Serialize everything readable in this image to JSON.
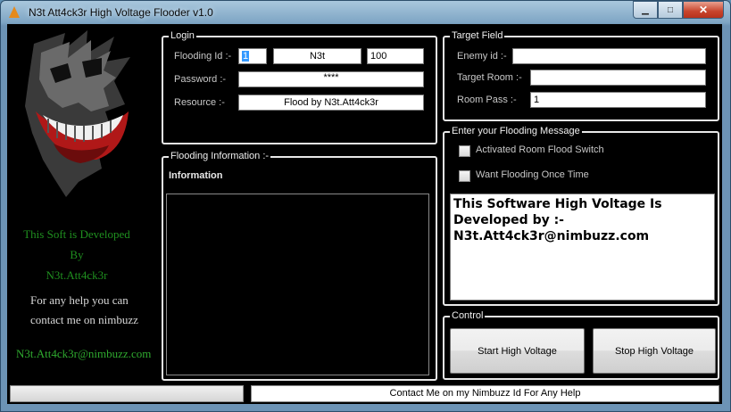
{
  "window": {
    "title": "N3t Att4ck3r High Voltage Flooder v1.0",
    "minimize": "▁",
    "maximize": "□",
    "close": "✕"
  },
  "sidebar": {
    "dev_line1": "This Soft is Developed",
    "dev_line2": "By",
    "dev_line3": "N3t.Att4ck3r",
    "help_line1": "For any help you can",
    "help_line2": "contact me on nimbuzz",
    "contact": "N3t.Att4ck3r@nimbuzz.com",
    "accent_green": "#1f8f1f"
  },
  "login": {
    "group_title": "Login",
    "flooding_id_label": "Flooding Id :-",
    "flooding_id_value": "1",
    "name_value": "N3t",
    "count_value": "100",
    "password_label": "Password :-",
    "password_value": "****",
    "resource_label": "Resource :-",
    "resource_value": "Flood by N3t.Att4ck3r"
  },
  "target": {
    "group_title": "Target Field",
    "enemy_label": "Enemy id :-",
    "enemy_value": "",
    "room_label": "Target Room :-",
    "room_value": "",
    "pass_label": "Room Pass :-",
    "pass_value": "1"
  },
  "info": {
    "group_title": "Flooding Information :-",
    "heading": "Information"
  },
  "message": {
    "group_title": "Enter your Flooding Message",
    "check1": "Activated Room Flood Switch",
    "check2": "Want Flooding Once Time",
    "text": "This Software High Voltage Is Developed by :- N3t.Att4ck3r@nimbuzz.com"
  },
  "control": {
    "group_title": "Control",
    "start": "Start High Voltage",
    "stop": "Stop High Voltage"
  },
  "status": {
    "progress": 0,
    "contact_text": "Contact Me on my Nimbuzz Id For Any Help"
  }
}
